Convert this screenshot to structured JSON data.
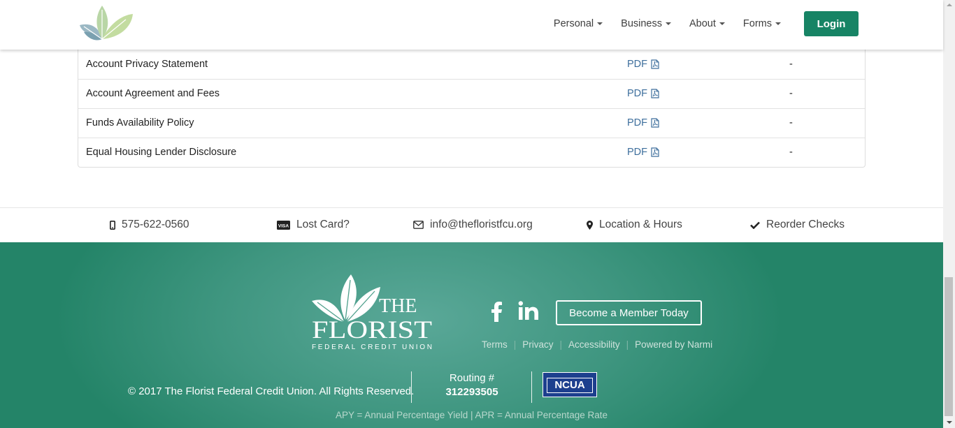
{
  "nav": {
    "items": [
      {
        "label": "Personal"
      },
      {
        "label": "Business"
      },
      {
        "label": "About"
      },
      {
        "label": "Forms"
      }
    ],
    "login_label": "Login"
  },
  "documents": {
    "rows": [
      {
        "name": "Account Privacy Statement",
        "pdf": "PDF",
        "extra": "-"
      },
      {
        "name": "Account Agreement and Fees",
        "pdf": "PDF",
        "extra": "-"
      },
      {
        "name": "Funds Availability Policy",
        "pdf": "PDF",
        "extra": "-"
      },
      {
        "name": "Equal Housing Lender Disclosure",
        "pdf": "PDF",
        "extra": "-"
      }
    ]
  },
  "quick_links": {
    "phone": "575-622-0560",
    "lost_card": "Lost Card?",
    "email": "info@thefloristfcu.org",
    "location": "Location & Hours",
    "reorder": "Reorder Checks"
  },
  "footer": {
    "brand_the": "THE",
    "brand_florist": "FLORIST",
    "brand_tagline": "FEDERAL CREDIT UNION",
    "member_button": "Become a Member Today",
    "links": [
      "Terms",
      "Privacy",
      "Accessibility",
      "Powered by Narmi"
    ],
    "copyright": "© 2017 The Florist Federal Credit Union. All Rights Reserved.",
    "routing_label": "Routing #",
    "routing_number": "312293505",
    "ncua": "NCUA",
    "apy_note": "APY = Annual Percentage Yield | APR = Annual Percentage Rate"
  },
  "colors": {
    "accent": "#178465",
    "link": "#3d6e9c",
    "footer_bg": "#3f9680"
  },
  "icons": {
    "phone": "mobile-phone-icon",
    "lost_card": "visa-card-icon",
    "email": "envelope-icon",
    "location": "map-marker-icon",
    "reorder": "checkmark-icon",
    "pdf": "pdf-file-icon",
    "facebook": "facebook-icon",
    "linkedin": "linkedin-icon"
  }
}
